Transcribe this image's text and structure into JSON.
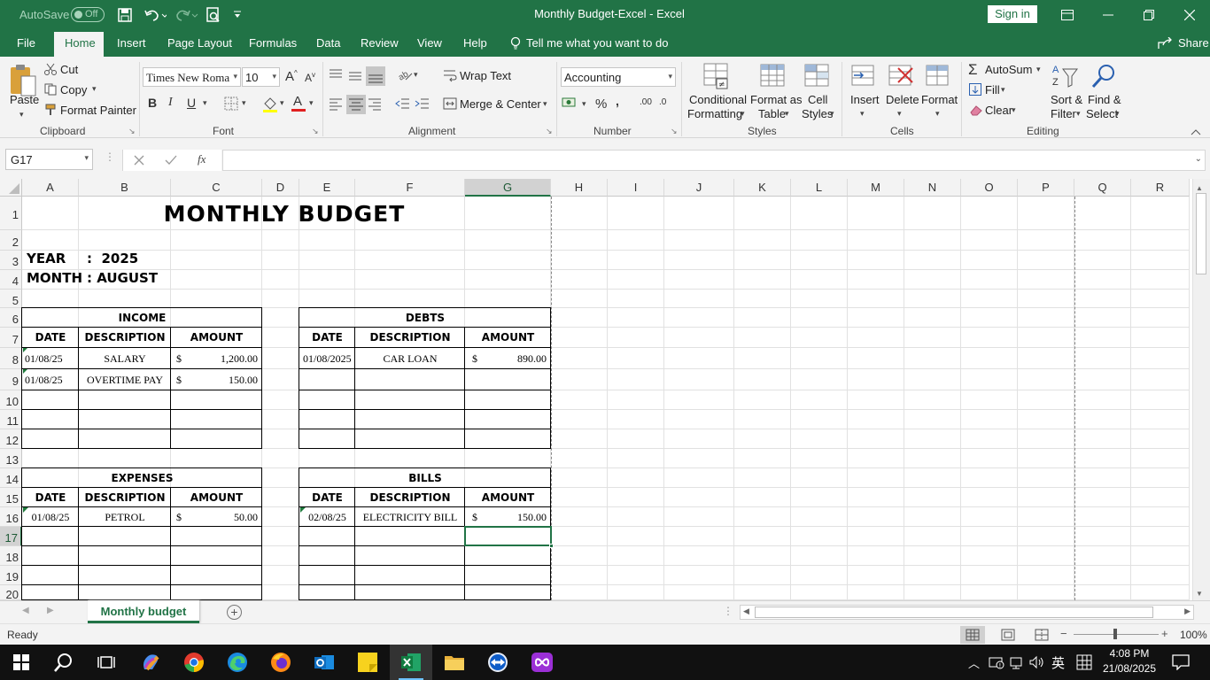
{
  "titlebar": {
    "autosave_label": "AutoSave",
    "autosave_state": "Off",
    "title": "Monthly Budget-Excel  -  Excel",
    "sign_in": "Sign in"
  },
  "menu": [
    "File",
    "Home",
    "Insert",
    "Page Layout",
    "Formulas",
    "Data",
    "Review",
    "View",
    "Help"
  ],
  "tell_me": "Tell me what you want to do",
  "share": "Share",
  "ribbon": {
    "clipboard": {
      "paste": "Paste",
      "cut": "Cut",
      "copy": "Copy",
      "format_painter": "Format Painter",
      "label": "Clipboard"
    },
    "font": {
      "name": "Times New Roma",
      "size": "10",
      "bold": "B",
      "italic": "I",
      "underline": "U",
      "label": "Font"
    },
    "alignment": {
      "wrap": "Wrap Text",
      "merge": "Merge & Center",
      "label": "Alignment"
    },
    "number": {
      "format": "Accounting",
      "label": "Number"
    },
    "styles": {
      "conditional": [
        "Conditional",
        "Formatting"
      ],
      "format_table": [
        "Format as",
        "Table"
      ],
      "cell_styles": [
        "Cell",
        "Styles"
      ],
      "label": "Styles"
    },
    "cells": {
      "insert": "Insert",
      "delete": "Delete",
      "format": "Format",
      "label": "Cells"
    },
    "editing": {
      "autosum": "AutoSum",
      "fill": "Fill",
      "clear": "Clear",
      "sort": [
        "Sort &",
        "Filter"
      ],
      "find": [
        "Find &",
        "Select"
      ],
      "label": "Editing"
    }
  },
  "formula": {
    "name_box": "G17",
    "fx": "fx",
    "content": ""
  },
  "columns": [
    "A",
    "B",
    "C",
    "D",
    "E",
    "F",
    "G",
    "H",
    "I",
    "J",
    "K",
    "L",
    "M",
    "N",
    "O",
    "P",
    "Q",
    "R"
  ],
  "rows": [
    "1",
    "2",
    "3",
    "4",
    "5",
    "6",
    "7",
    "8",
    "9",
    "10",
    "11",
    "12",
    "13",
    "14",
    "15",
    "16",
    "17",
    "18",
    "19",
    "20"
  ],
  "sheet": {
    "title": "MONTHLY BUDGET",
    "year_label": "YEAR",
    "year_value": ":  2025",
    "month_label": "MONTH",
    "month_value": ": AUGUST",
    "income": {
      "title": "INCOME",
      "headers": [
        "DATE",
        "DESCRIPTION",
        "AMOUNT"
      ],
      "rows": [
        {
          "date": "01/08/25",
          "desc": "SALARY",
          "cur": "$",
          "amount": "1,200.00"
        },
        {
          "date": "01/08/25",
          "desc": "OVERTIME PAY",
          "cur": "$",
          "amount": "150.00"
        }
      ]
    },
    "debts": {
      "title": "DEBTS",
      "headers": [
        "DATE",
        "DESCRIPTION",
        "AMOUNT"
      ],
      "rows": [
        {
          "date": "01/08/2025",
          "desc": "CAR LOAN",
          "cur": "$",
          "amount": "890.00"
        }
      ]
    },
    "expenses": {
      "title": "EXPENSES",
      "headers": [
        "DATE",
        "DESCRIPTION",
        "AMOUNT"
      ],
      "rows": [
        {
          "date": "01/08/25",
          "desc": "PETROL",
          "cur": "$",
          "amount": "50.00"
        }
      ]
    },
    "bills": {
      "title": "BILLS",
      "headers": [
        "DATE",
        "DESCRIPTION",
        "AMOUNT"
      ],
      "rows": [
        {
          "date": "02/08/25",
          "desc": "ELECTRICITY BILL",
          "cur": "$",
          "amount": "150.00"
        }
      ]
    }
  },
  "sheet_tab": "Monthly budget",
  "status": {
    "ready": "Ready",
    "zoom": "100%"
  },
  "taskbar": {
    "time": "4:08 PM",
    "date": "21/08/2025",
    "ime": "英"
  },
  "colors": {
    "excel_green": "#217346",
    "selection": "#217346"
  }
}
